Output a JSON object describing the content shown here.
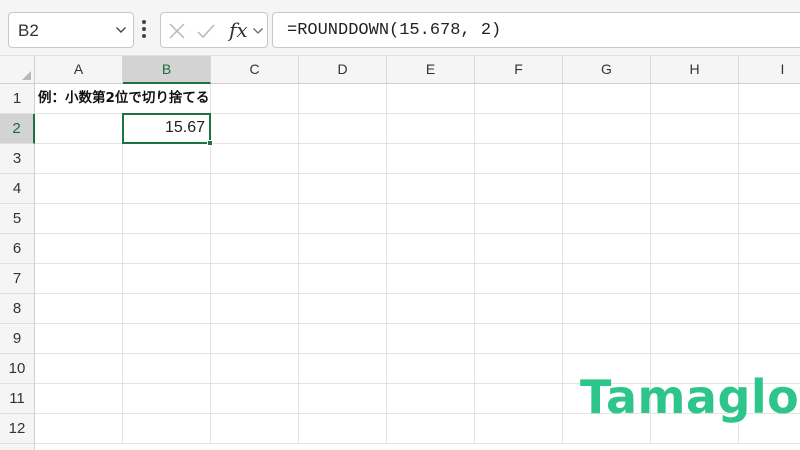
{
  "formula_bar": {
    "name_box": "B2",
    "fx_label": "fx",
    "formula": "=ROUNDDOWN(15.678, 2)"
  },
  "columns": [
    "A",
    "B",
    "C",
    "D",
    "E",
    "F",
    "G",
    "H",
    "I"
  ],
  "rows": [
    "1",
    "2",
    "3",
    "4",
    "5",
    "6",
    "7",
    "8",
    "9",
    "10",
    "11",
    "12"
  ],
  "selected_column": "B",
  "selected_row": "2",
  "cells": {
    "A1": "例：小数第2位で切り捨てる",
    "B2": "15.67"
  },
  "logo": "Tamaglo",
  "colors": {
    "selection": "#1e7145",
    "logo": "#2ec58a"
  },
  "icons": [
    "chevron-down-icon",
    "more-icon",
    "cancel-icon",
    "confirm-icon",
    "fx-icon"
  ]
}
